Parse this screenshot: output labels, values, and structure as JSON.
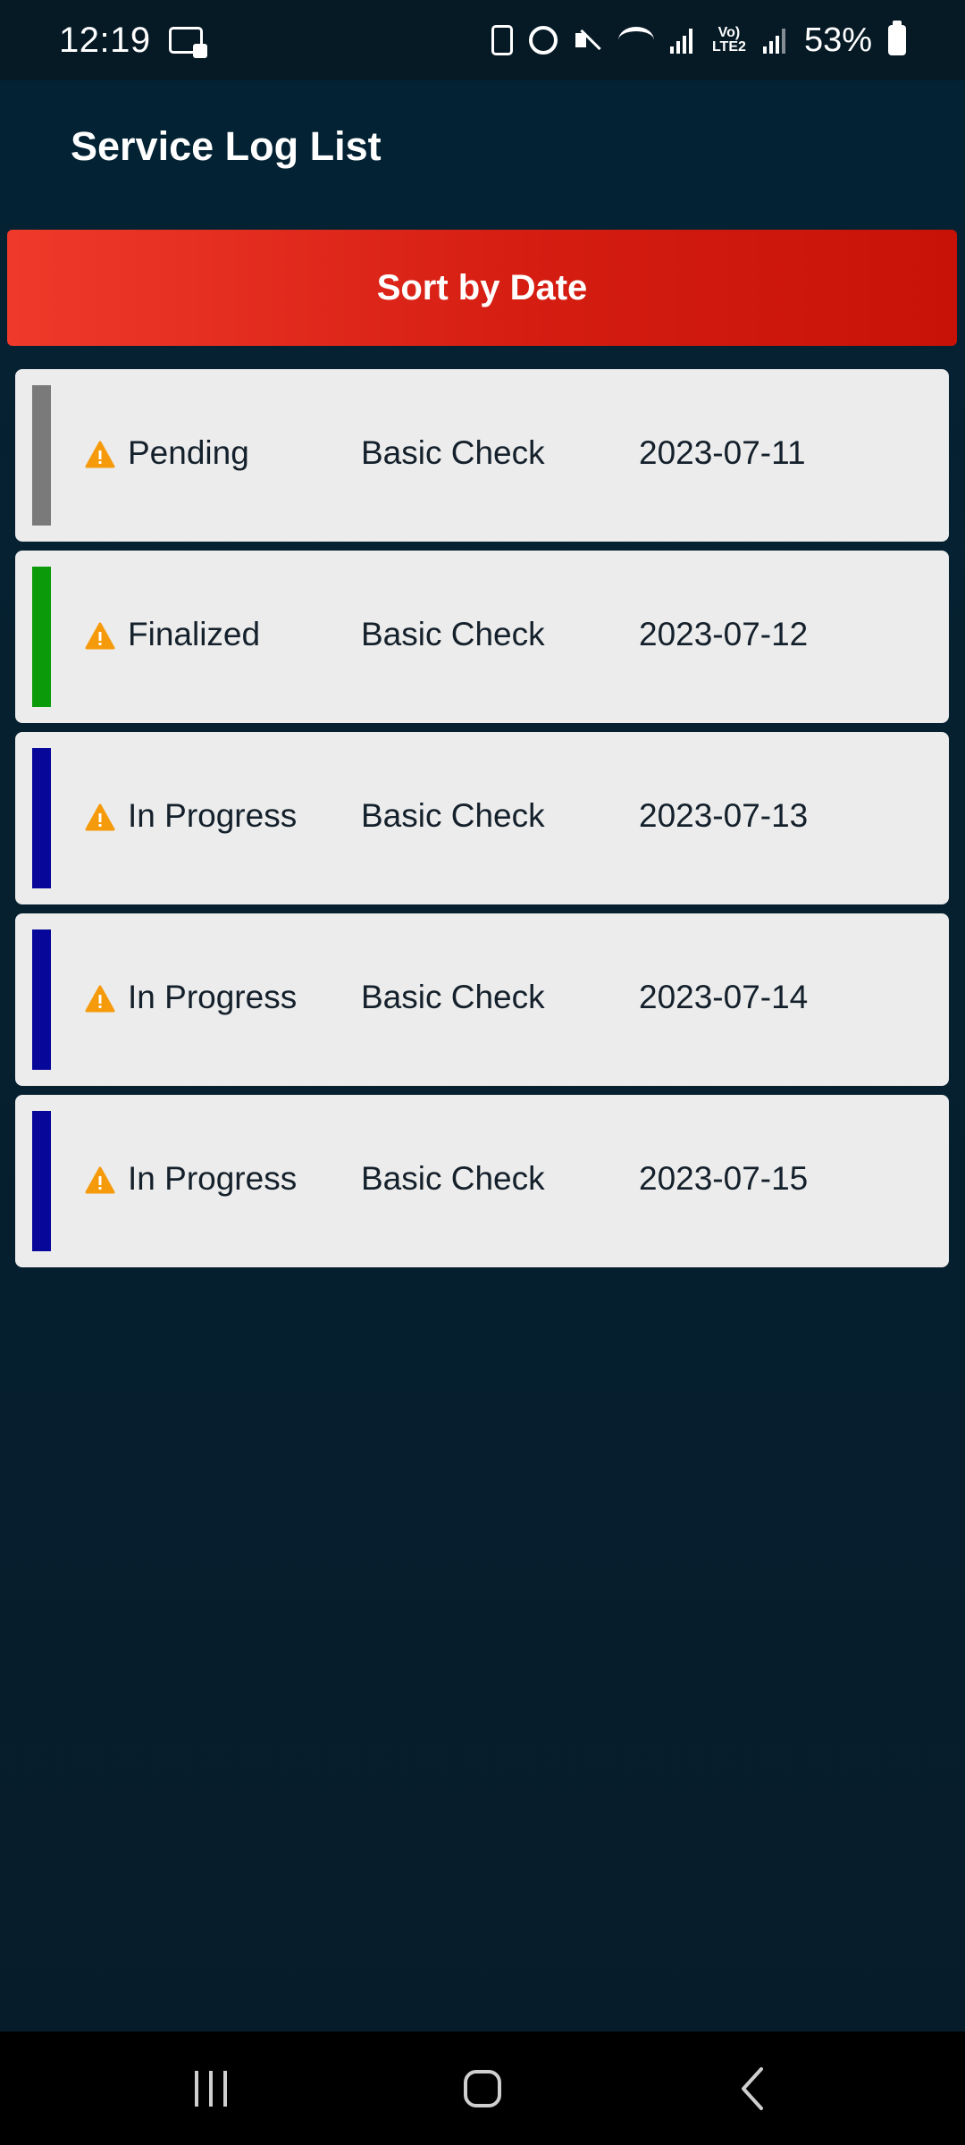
{
  "status_bar": {
    "time": "12:19",
    "battery_percent": "53%",
    "network_label": "Vo) LTE2"
  },
  "header": {
    "title": "Service Log List"
  },
  "sort_button": {
    "label": "Sort by Date"
  },
  "logs": [
    {
      "status": "Pending",
      "type": "Basic Check",
      "date": "2023-07-11",
      "strip_color": "#7a7a7a"
    },
    {
      "status": "Finalized",
      "type": "Basic Check",
      "date": "2023-07-12",
      "strip_color": "#0a9a0a"
    },
    {
      "status": "In Progress",
      "type": "Basic Check",
      "date": "2023-07-13",
      "strip_color": "#07079a"
    },
    {
      "status": "In Progress",
      "type": "Basic Check",
      "date": "2023-07-14",
      "strip_color": "#07079a"
    },
    {
      "status": "In Progress",
      "type": "Basic Check",
      "date": "2023-07-15",
      "strip_color": "#07079a"
    }
  ],
  "icons": {
    "warning": "warning-triangle-icon",
    "nav_recents": "recents-icon",
    "nav_home": "home-icon",
    "nav_back": "back-icon"
  },
  "colors": {
    "background": "#052233",
    "accent_red": "#d51d12",
    "card": "#ececec",
    "warning": "#f59a0b"
  }
}
